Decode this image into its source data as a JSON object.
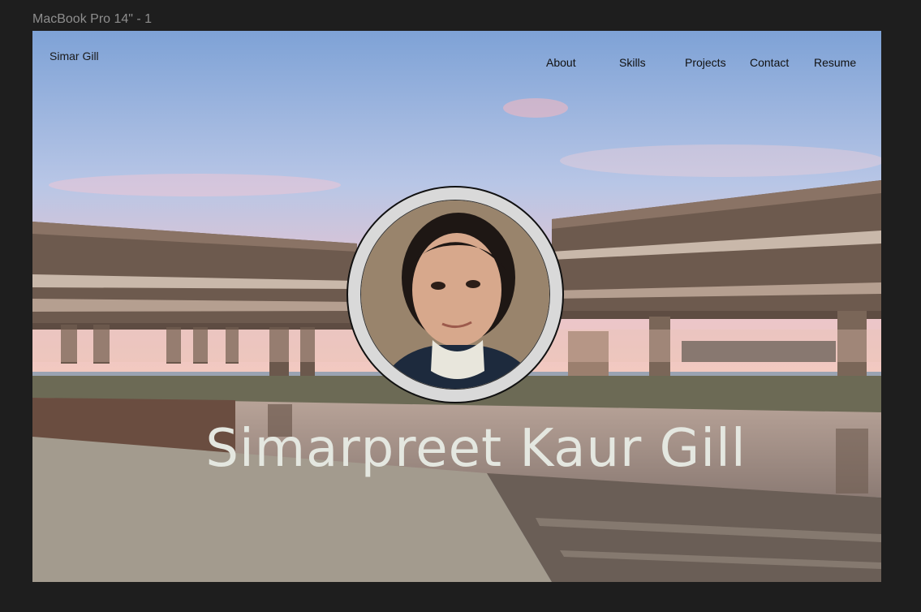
{
  "frame": {
    "label": "MacBook Pro 14\" - 1"
  },
  "header": {
    "logo": "Simar Gill",
    "nav": {
      "about": "About",
      "skills": "Skills",
      "projects": "Projects",
      "contact": "Contact",
      "resume": "Resume"
    }
  },
  "hero": {
    "name": "Simarpreet Kaur Gill",
    "background": "campus-building-photo",
    "avatar": "profile-photo"
  },
  "colors": {
    "canvas_background": "#1e1e1e",
    "frame_label": "#8e8e8e",
    "nav_text": "#111111",
    "hero_text": "#e4e7e0",
    "avatar_ring": "#d9d9d9"
  }
}
